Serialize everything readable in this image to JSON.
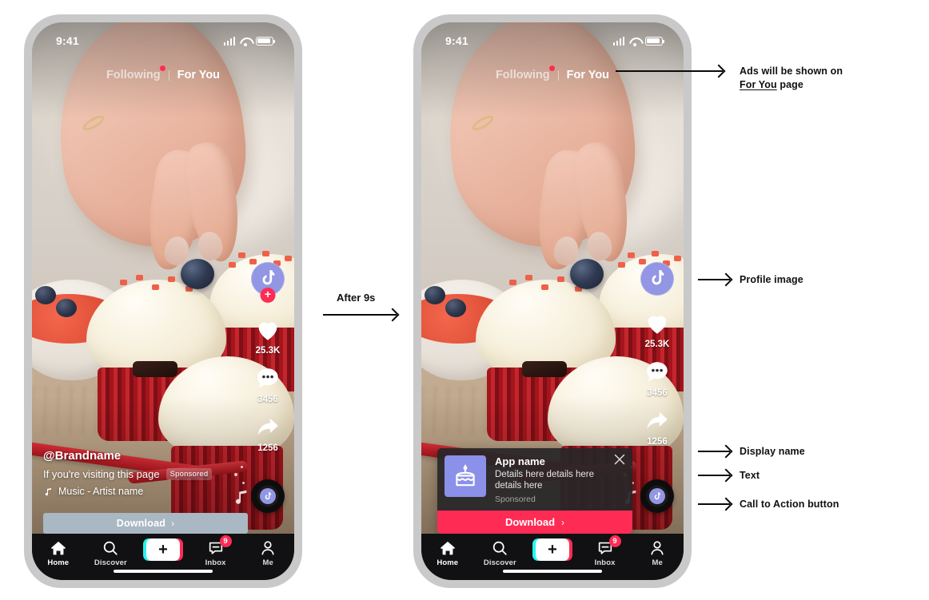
{
  "phones": [
    {
      "id": "before",
      "status_bar": {
        "time": "9:41",
        "signal": "signal-bars",
        "wifi": "wifi",
        "battery": "battery"
      },
      "feed_tabs": {
        "following": "Following",
        "for_you": "For You"
      },
      "rail": {
        "like_count": "25.3K",
        "comment_count": "3456",
        "share_count": "1256"
      },
      "caption": {
        "brand": "@Brandname",
        "text": "If you're visiting this page",
        "sponsored": "Sponsored",
        "music": "Music - Artist name"
      },
      "cta": {
        "label": "Download",
        "chevron": "›"
      }
    },
    {
      "id": "after",
      "status_bar": {
        "time": "9:41",
        "signal": "signal-bars",
        "wifi": "wifi",
        "battery": "battery"
      },
      "feed_tabs": {
        "following": "Following",
        "for_you": "For You"
      },
      "rail": {
        "like_count": "25.3K",
        "comment_count": "3456",
        "share_count": "1256"
      },
      "ad_card": {
        "title": "App name",
        "description": "Details here details here details here",
        "sponsored": "Sponsored",
        "cta": "Download",
        "chevron": "›",
        "close": "close-icon"
      }
    }
  ],
  "navbar": {
    "items": [
      {
        "label": "Home",
        "icon": "home-icon",
        "active": true
      },
      {
        "label": "Discover",
        "icon": "search-icon",
        "active": false
      },
      {
        "label": "",
        "icon": "create-plus-icon",
        "active": false
      },
      {
        "label": "Inbox",
        "icon": "inbox-icon",
        "badge": "9",
        "active": false
      },
      {
        "label": "Me",
        "icon": "person-icon",
        "active": false
      }
    ]
  },
  "transition": {
    "label": "After 9s"
  },
  "annotations": [
    {
      "id": "for-you-page",
      "line1": "Ads will be shown on",
      "line2_underlined": "For You",
      "line2_rest": " page"
    },
    {
      "id": "profile-image",
      "text": "Profile image"
    },
    {
      "id": "display-name",
      "text": "Display name"
    },
    {
      "id": "ad-text",
      "text": "Text"
    },
    {
      "id": "cta-button",
      "text": "Call to Action button"
    }
  ],
  "colors": {
    "tiktok_red": "#FE2C55",
    "tiktok_cyan": "#26F4EE",
    "avatar_purple": "#9296E3",
    "app_icon_purple": "#8B90E8",
    "plain_cta": "#A9B8C2",
    "phone_frame": "#C9C9C9",
    "nav_bg": "#111013"
  }
}
